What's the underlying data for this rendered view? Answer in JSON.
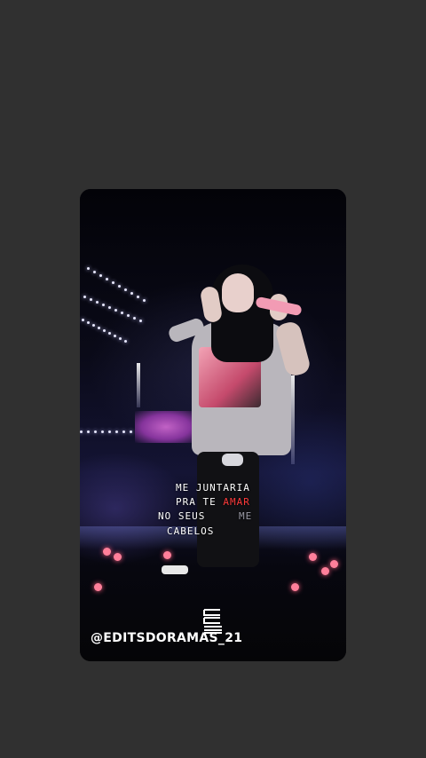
{
  "story": {
    "lyrics": {
      "line1": "ME JUNTARIA",
      "line2_a": "PRA TE ",
      "line2_b": "AMAR",
      "line3": "NO SEUS",
      "line3_side": "ME",
      "line4": "CABELOS"
    },
    "watermark": {
      "logo_icon": "cc-logo-icon",
      "handle": "@EDITSDORAMAS_21"
    },
    "colors": {
      "page_background": "#303030",
      "lyric_accent": "#ff3b3b",
      "lyric_text": "#ffffff"
    }
  }
}
